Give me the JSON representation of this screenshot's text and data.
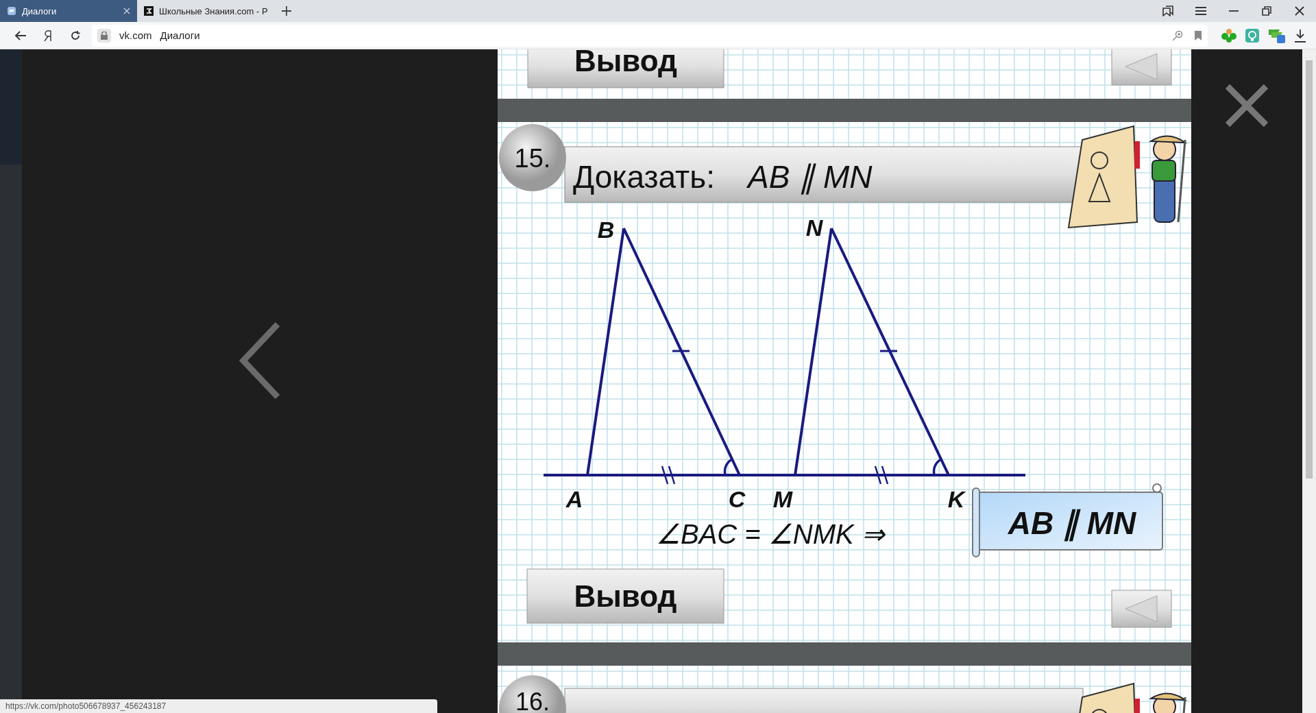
{
  "browser": {
    "tabs": [
      {
        "title": "Диалоги",
        "selected": true
      },
      {
        "title": "Школьные Знания.com - Р",
        "selected": false
      }
    ],
    "address": {
      "domain": "vk.com",
      "page_title": "Диалоги"
    },
    "status_url": "https://vk.com/photo506678937_456243187"
  },
  "photo": {
    "previous_section": {
      "button": "Вывод"
    },
    "section": {
      "number": "15.",
      "title_label": "Доказать:",
      "title_formula": "AB ∥ MN",
      "points": [
        {
          "label": "A"
        },
        {
          "label": "B"
        },
        {
          "label": "C"
        },
        {
          "label": "M"
        },
        {
          "label": "N"
        },
        {
          "label": "K"
        }
      ],
      "formula": "∠BAC = ∠NMK ⇒",
      "result": "AB ∥ MN",
      "button": "Вывод"
    },
    "next_section": {
      "number": "16."
    }
  }
}
